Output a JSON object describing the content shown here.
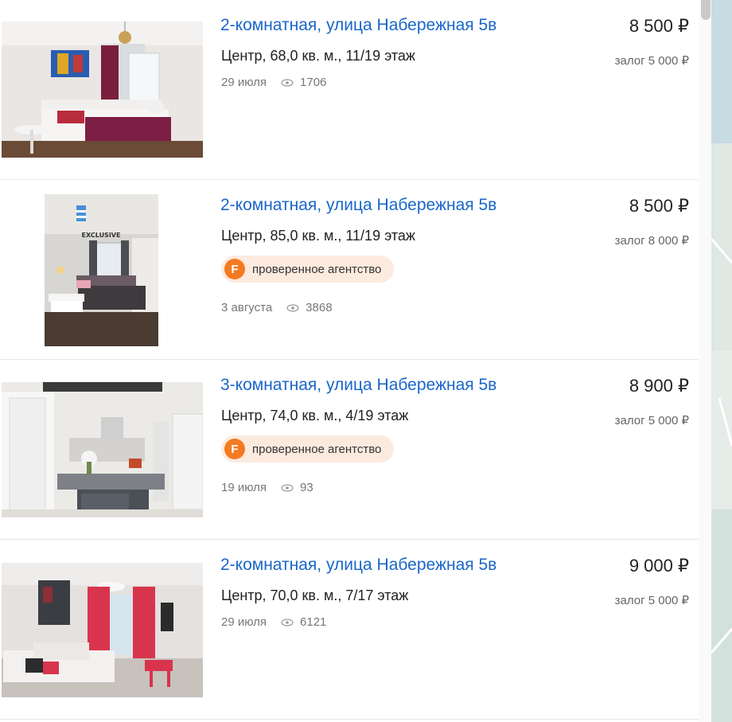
{
  "listings": [
    {
      "title": "2-комнатная, улица Набережная 5в",
      "details": "Центр, 68,0 кв. м., 11/19 этаж",
      "price": "8 500 ₽",
      "deposit": "залог 5 000 ₽",
      "date": "29 июля",
      "views": "1706"
    },
    {
      "title": "2-комнатная, улица Набережная 5в",
      "details": "Центр, 85,0 кв. м., 11/19 этаж",
      "price": "8 500 ₽",
      "deposit": "залог 8 000 ₽",
      "badge": "проверенное агентство",
      "badge_logo": "F",
      "date": "3 августа",
      "views": "3868",
      "photo_logo_text": "EXCLUSIVE"
    },
    {
      "title": "3-комнатная, улица Набережная 5в",
      "details": "Центр, 74,0 кв. м., 4/19 этаж",
      "price": "8 900 ₽",
      "deposit": "залог 5 000 ₽",
      "badge": "проверенное агентство",
      "badge_logo": "F",
      "date": "19 июля",
      "views": "93"
    },
    {
      "title": "2-комнатная, улица Набережная 5в",
      "details": "Центр, 70,0 кв. м., 7/17 этаж",
      "price": "9 000 ₽",
      "deposit": "залог 5 000 ₽",
      "date": "29 июля",
      "views": "6121"
    }
  ],
  "icons": {
    "views": "eye-icon",
    "agency": "agency-f-logo-icon"
  },
  "colors": {
    "title_link": "#1a66c9",
    "badge_bg": "#fdeadf",
    "badge_logo": "#f47a22",
    "meta_text": "#777777"
  }
}
